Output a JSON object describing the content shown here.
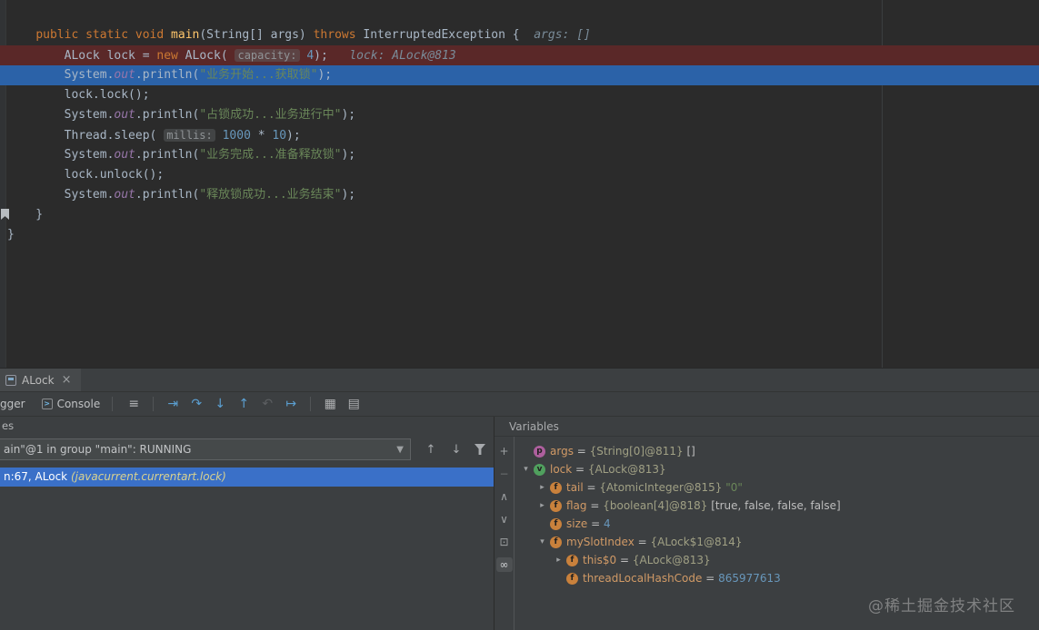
{
  "editor": {
    "lines": [
      {
        "tokens": []
      },
      {
        "tokens": [
          [
            "    ",
            "p"
          ],
          [
            "public",
            "k"
          ],
          [
            " ",
            "p"
          ],
          [
            "static",
            "k"
          ],
          [
            " ",
            "p"
          ],
          [
            "void",
            "k"
          ],
          [
            " ",
            "p"
          ],
          [
            "main",
            "d"
          ],
          [
            "(String[] args) ",
            "p"
          ],
          [
            "throws",
            "k"
          ],
          [
            " InterruptedException {",
            "p"
          ],
          [
            "  ",
            "p"
          ],
          [
            "args: []",
            "h"
          ]
        ]
      },
      {
        "bg": "break",
        "tokens": [
          [
            "        ALock lock = ",
            "p"
          ],
          [
            "new",
            "k"
          ],
          [
            " ALock( ",
            "p"
          ],
          [
            "capacity:",
            "ph"
          ],
          [
            " ",
            "p"
          ],
          [
            "4",
            "n"
          ],
          [
            ");",
            "p"
          ],
          [
            "   ",
            "p"
          ],
          [
            "lock: ALock@813",
            "h"
          ]
        ]
      },
      {
        "bg": "exec",
        "tokens": [
          [
            "        System.",
            "p"
          ],
          [
            "out",
            "f"
          ],
          [
            ".println(",
            "p"
          ],
          [
            "\"业务开始...获取锁\"",
            "s"
          ],
          [
            ");",
            "p"
          ]
        ]
      },
      {
        "tokens": [
          [
            "        lock.lock();",
            "p"
          ]
        ]
      },
      {
        "tokens": [
          [
            "        System.",
            "p"
          ],
          [
            "out",
            "f"
          ],
          [
            ".println(",
            "p"
          ],
          [
            "\"占锁成功...业务进行中\"",
            "s"
          ],
          [
            ");",
            "p"
          ]
        ]
      },
      {
        "tokens": [
          [
            "        Thread.sleep( ",
            "p"
          ],
          [
            "millis:",
            "ph"
          ],
          [
            " ",
            "p"
          ],
          [
            "1000",
            "n"
          ],
          [
            " * ",
            "p"
          ],
          [
            "10",
            "n"
          ],
          [
            ");",
            "p"
          ]
        ]
      },
      {
        "tokens": [
          [
            "        System.",
            "p"
          ],
          [
            "out",
            "f"
          ],
          [
            ".println(",
            "p"
          ],
          [
            "\"业务完成...准备释放锁\"",
            "s"
          ],
          [
            ");",
            "p"
          ]
        ]
      },
      {
        "tokens": [
          [
            "        lock.unlock();",
            "p"
          ]
        ]
      },
      {
        "tokens": [
          [
            "        System.",
            "p"
          ],
          [
            "out",
            "f"
          ],
          [
            ".println(",
            "p"
          ],
          [
            "\"释放锁成功...业务结束\"",
            "s"
          ],
          [
            ");",
            "p"
          ]
        ]
      },
      {
        "tokens": [
          [
            "    }",
            "p"
          ]
        ]
      },
      {
        "tokens": [
          [
            "}",
            "p"
          ]
        ]
      }
    ]
  },
  "debug": {
    "tab": {
      "label": "ALock",
      "close_glyph": "×"
    },
    "toolbar": {
      "debugger_tab": "gger",
      "console_tab": "Console",
      "icons": [
        {
          "name": "menu-icon",
          "glyph": "≡",
          "color": "#afb1b3"
        },
        {
          "sep": true
        },
        {
          "name": "show-execution-point-icon",
          "glyph": "⇥",
          "color": "#5b9fd1"
        },
        {
          "name": "step-over-icon",
          "glyph": "↷",
          "color": "#5b9fd1"
        },
        {
          "name": "step-into-icon",
          "glyph": "↓",
          "color": "#5b9fd1"
        },
        {
          "name": "step-out-icon",
          "glyph": "↑",
          "color": "#5b9fd1"
        },
        {
          "name": "drop-frame-icon",
          "glyph": "↶",
          "color": "#77797c",
          "enabled": false
        },
        {
          "name": "run-to-cursor-icon",
          "glyph": "↦",
          "color": "#5b9fd1"
        },
        {
          "sep": true
        },
        {
          "name": "view-as-table-icon",
          "glyph": "▦",
          "color": "#afb1b3"
        },
        {
          "name": "layout-settings-icon",
          "glyph": "▤",
          "color": "#afb1b3"
        }
      ]
    },
    "frames": {
      "panel_label": "es",
      "thread_selector_value": "ain\"@1 in group \"main\": RUNNING",
      "nav_icons": [
        {
          "name": "previous-frame-icon",
          "glyph": "↑"
        },
        {
          "name": "next-frame-icon",
          "glyph": "↓"
        },
        {
          "name": "filter-frames-icon",
          "shape": "funnel"
        }
      ],
      "rows": [
        {
          "location": "n:67, ALock ",
          "package": "(javacurrent.currentart.lock)",
          "selected": true
        }
      ]
    },
    "variables": {
      "header": "Variables",
      "strip_icons": [
        {
          "name": "add-icon",
          "glyph": "+"
        },
        {
          "name": "remove-icon",
          "glyph": "−",
          "enabled": false
        },
        {
          "name": "chevron-up-icon",
          "glyph": "∧"
        },
        {
          "name": "chevron-down-icon",
          "glyph": "∨"
        },
        {
          "name": "copy-icon",
          "glyph": "⊡"
        },
        {
          "name": "infinity-icon",
          "glyph": "∞",
          "active": true
        }
      ],
      "rows": [
        {
          "indent": 0,
          "exp": null,
          "icon": "p",
          "icon_name": "parameter-icon",
          "icon_bg": "#ad5f9d",
          "segs": [
            [
              "args",
              "name"
            ],
            [
              " = ",
              "eq"
            ],
            [
              "{String[0]@811} ",
              "ref"
            ],
            [
              "[]",
              "val"
            ]
          ]
        },
        {
          "indent": 0,
          "exp": "open",
          "icon": "v",
          "icon_name": "local-variable-icon",
          "icon_bg": "#50a05e",
          "segs": [
            [
              "lock",
              "name"
            ],
            [
              " = ",
              "eq"
            ],
            [
              "{ALock@813}",
              "ref"
            ]
          ]
        },
        {
          "indent": 1,
          "exp": "closed",
          "icon": "f",
          "icon_name": "field-icon",
          "icon_bg": "#c9813c",
          "segs": [
            [
              "tail",
              "name"
            ],
            [
              " = ",
              "eq"
            ],
            [
              "{AtomicInteger@815} ",
              "ref"
            ],
            [
              "\"0\"",
              "str"
            ]
          ]
        },
        {
          "indent": 1,
          "exp": "closed",
          "icon": "f",
          "icon_name": "field-icon",
          "icon_bg": "#c9813c",
          "segs": [
            [
              "flag",
              "name"
            ],
            [
              " = ",
              "eq"
            ],
            [
              "{boolean[4]@818} ",
              "ref"
            ],
            [
              "[true, false, false, false]",
              "val"
            ]
          ]
        },
        {
          "indent": 1,
          "exp": null,
          "icon": "f",
          "icon_name": "field-icon",
          "icon_bg": "#c9813c",
          "segs": [
            [
              "size",
              "name"
            ],
            [
              " = ",
              "eq"
            ],
            [
              "4",
              "num"
            ]
          ]
        },
        {
          "indent": 1,
          "exp": "open",
          "icon": "f",
          "icon_name": "field-icon",
          "icon_bg": "#c9813c",
          "segs": [
            [
              "mySlotIndex",
              "name"
            ],
            [
              " = ",
              "eq"
            ],
            [
              "{ALock$1@814}",
              "ref"
            ]
          ]
        },
        {
          "indent": 2,
          "exp": "closed",
          "icon": "f",
          "icon_name": "field-icon",
          "icon_bg": "#c9813c",
          "segs": [
            [
              "this$0",
              "name"
            ],
            [
              " = ",
              "eq"
            ],
            [
              "{ALock@813}",
              "ref"
            ]
          ]
        },
        {
          "indent": 2,
          "exp": null,
          "icon": "f",
          "icon_name": "field-icon",
          "icon_bg": "#c9813c",
          "segs": [
            [
              "threadLocalHashCode",
              "name"
            ],
            [
              " = ",
              "eq"
            ],
            [
              "865977613",
              "num"
            ]
          ]
        }
      ]
    }
  },
  "watermark": "@稀土掘金技术社区"
}
